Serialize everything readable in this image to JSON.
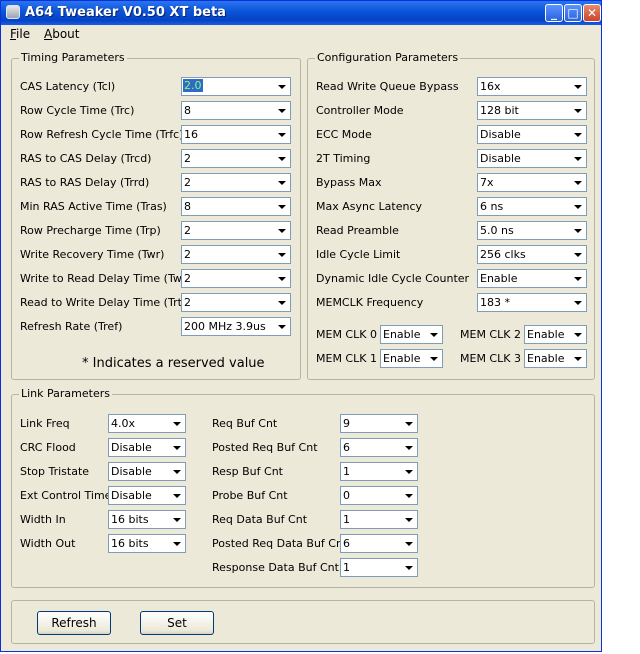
{
  "window": {
    "title": "A64 Tweaker V0.50 XT beta",
    "controls": {
      "minimize": "_",
      "maximize": "□",
      "close": "✕"
    },
    "icon": "chip-icon"
  },
  "menu": [
    {
      "label": "File",
      "mnemonic": "F"
    },
    {
      "label": "About",
      "mnemonic": "A"
    }
  ],
  "timing": {
    "title": "Timing Parameters",
    "rows": [
      {
        "label": "CAS Latency (Tcl)",
        "value": "2.0"
      },
      {
        "label": "Row Cycle Time (Trc)",
        "value": "8"
      },
      {
        "label": "Row Refresh Cycle Time (Trfc)",
        "value": "16"
      },
      {
        "label": "RAS to CAS Delay (Trcd)",
        "value": "2"
      },
      {
        "label": "RAS to RAS Delay (Trrd)",
        "value": "2"
      },
      {
        "label": "Min RAS Active Time (Tras)",
        "value": "8"
      },
      {
        "label": "Row Precharge Time (Trp)",
        "value": "2"
      },
      {
        "label": "Write Recovery Time (Twr)",
        "value": "2"
      },
      {
        "label": "Write to Read Delay Time (Twtr)",
        "value": "2"
      },
      {
        "label": "Read to Write Delay Time (Trtw)",
        "value": "2"
      },
      {
        "label": "Refresh Rate (Tref)",
        "value": "200 MHz 3.9us"
      }
    ],
    "note": "* Indicates a reserved value"
  },
  "config": {
    "title": "Configuration Parameters",
    "rows": [
      {
        "label": "Read Write Queue Bypass",
        "value": "16x"
      },
      {
        "label": "Controller Mode",
        "value": "128 bit"
      },
      {
        "label": "ECC Mode",
        "value": "Disable"
      },
      {
        "label": "2T Timing",
        "value": "Disable"
      },
      {
        "label": "Bypass Max",
        "value": "7x"
      },
      {
        "label": "Max Async Latency",
        "value": "6 ns"
      },
      {
        "label": "Read Preamble",
        "value": "5.0 ns"
      },
      {
        "label": "Idle Cycle Limit",
        "value": "256 clks"
      },
      {
        "label": "Dynamic Idle Cycle Counter",
        "value": "Enable"
      },
      {
        "label": "MEMCLK Frequency",
        "value": "183 *"
      }
    ],
    "memclk": [
      {
        "label": "MEM CLK 0",
        "value": "Enable"
      },
      {
        "label": "MEM CLK 2",
        "value": "Enable"
      },
      {
        "label": "MEM CLK 1",
        "value": "Enable"
      },
      {
        "label": "MEM CLK 3",
        "value": "Enable"
      }
    ]
  },
  "link": {
    "title": "Link Parameters",
    "left": [
      {
        "label": "Link Freq",
        "value": "4.0x"
      },
      {
        "label": "CRC Flood",
        "value": "Disable"
      },
      {
        "label": "Stop Tristate",
        "value": "Disable"
      },
      {
        "label": "Ext Control Time",
        "value": "Disable"
      },
      {
        "label": "Width In",
        "value": "16 bits"
      },
      {
        "label": "Width Out",
        "value": "16 bits"
      }
    ],
    "right": [
      {
        "label": "Req Buf Cnt",
        "value": "9"
      },
      {
        "label": "Posted Req Buf Cnt",
        "value": "6"
      },
      {
        "label": "Resp Buf Cnt",
        "value": "1"
      },
      {
        "label": "Probe Buf Cnt",
        "value": "0"
      },
      {
        "label": "Req Data Buf Cnt",
        "value": "1"
      },
      {
        "label": "Posted Req Data Buf Cnt",
        "value": "6"
      },
      {
        "label": "Response Data Buf Cnt",
        "value": "1"
      }
    ]
  },
  "buttons": {
    "refresh": "Refresh",
    "set": "Set"
  }
}
